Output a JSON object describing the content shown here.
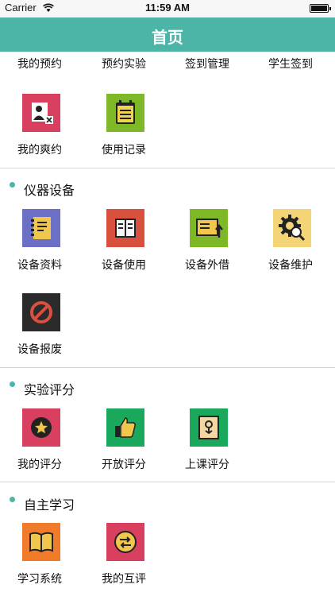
{
  "status": {
    "carrier": "Carrier",
    "time": "11:59 AM"
  },
  "nav": {
    "title": "首页"
  },
  "top_row": [
    "我的预约",
    "预约实验",
    "签到管理",
    "学生签到"
  ],
  "reservation": {
    "items": [
      "我的爽约",
      "使用记录"
    ]
  },
  "equipment": {
    "title": "仪器设备",
    "items": [
      "设备资料",
      "设备使用",
      "设备外借",
      "设备维护",
      "设备报废"
    ]
  },
  "evaluation": {
    "title": "实验评分",
    "items": [
      "我的评分",
      "开放评分",
      "上课评分"
    ]
  },
  "study": {
    "title": "自主学习",
    "items": [
      "学习系统",
      "我的互评"
    ]
  },
  "colors": {
    "accent": "#4db4a8",
    "section_dot": "#4db4a8"
  }
}
